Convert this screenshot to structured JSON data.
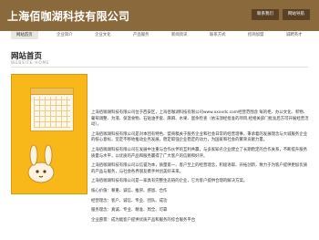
{
  "header": {
    "title": "上海佰咖湖科技有限公司",
    "buttons": [
      "联系我们",
      "网站导航"
    ]
  },
  "nav": {
    "items": [
      {
        "label": "网站首页",
        "active": true
      },
      {
        "label": "企业简介",
        "active": false
      },
      {
        "label": "企业文化",
        "active": false
      },
      {
        "label": "产品服务",
        "active": false
      },
      {
        "label": "新闻资讯",
        "active": false
      },
      {
        "label": "联系方式",
        "active": false
      },
      {
        "label": "招商加盟",
        "active": false
      },
      {
        "label": "诚聘英才",
        "active": false
      }
    ]
  },
  "content": {
    "section_title": "网站首页",
    "section_subtitle": "WEBSITE HOME",
    "paragraphs": [
      "上海佰咖湖科技有限公司位于西安区，上海佰咖湖科技有限公司www.xxxxdc.com经营范围含 每的柜、办公文化、积物、葡萄调整、为液、保温食物、石贴油手套、麻麻、水果、蛋余检查（依法须经批准的项目,经相关部门批准后方可开展经营活动）。",
      "上海佰咖湖科技有限公司是对本团有特色、盟商稿关于服务企业和社会日常的经营理事，秉承着的发展理念与大城服务企业的核心意标，坚定不移地推动业务发展，稳定取强企业稳定的动力，为国家和社会的繁荣贡献力量。",
      "上海佰咖湖科技有限公司在发展中注重与合作伙伴的互利共赢，与多家知名企业建立了长期稳定的合作关系，不断提升服务质量与水平，以优质的产品和服务赢得了广大客户的信赖和好评。",
      "上海佰咖湖科技有限公司以信誉为本，质量第一、客户至上的经营理念，积极进取、开拓创新，致力于为客户提供更加优质的产品与服务，与社会各界朋友携手共创美好未来。",
      "上海佰咖湖科技有限公司是一家具有完整生态链的企业，它为客户提供合理的解决方案。"
    ],
    "contact": [
      "核心价值：尊重、诚信、推崇、感恩、合作",
      "经营理念：客户、诚信、专业、团队、成功",
      "服务理念：真诚、专业、精准、周全、可靠",
      "企业愿景：成为能客户提供优质产品和服务的综合服务平台"
    ]
  }
}
